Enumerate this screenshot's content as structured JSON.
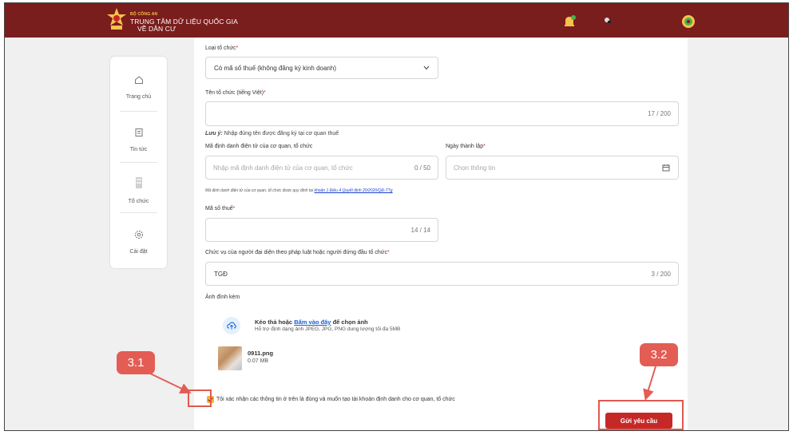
{
  "header": {
    "org_top": "BỘ CÔNG AN",
    "org_line1": "TRUNG TÂM DỮ LIỆU QUỐC GIA",
    "org_line2": "VỀ DÂN CƯ"
  },
  "sidebar": {
    "items": [
      {
        "label": "Trang chủ",
        "icon": "home-icon"
      },
      {
        "label": "Tin tức",
        "icon": "news-icon"
      },
      {
        "label": "Tổ chức",
        "icon": "building-icon"
      },
      {
        "label": "Cài đặt",
        "icon": "gear-icon"
      }
    ]
  },
  "form": {
    "org_type": {
      "label": "Loại tổ chức",
      "required": "*",
      "value": "Có mã số thuế (không đăng ký kinh doanh)"
    },
    "org_name": {
      "label": "Tên tổ chức (tiếng Việt)",
      "required": "*",
      "counter": "17 / 200"
    },
    "note_prefix": "Lưu ý:",
    "note_text": "Nhập đúng tên được đăng ký tại cơ quan thuế",
    "eid": {
      "label": "Mã định danh điện tử của cơ quan, tổ chức",
      "placeholder": "Nhập mã định danh điện tử của cơ quan, tổ chức",
      "counter": "0 / 50"
    },
    "founded": {
      "label": "Ngày thành lập",
      "required": "*",
      "placeholder": "Chọn thông tin"
    },
    "legal_text": "Mã định danh điện tử của cơ quan, tổ chức được quy định tại",
    "legal_link": "khoản 1 Điều 4 Quyết định 20/2020/QĐ-TTg",
    "tax": {
      "label": "Mã số thuế",
      "required": "*",
      "counter": "14 / 14"
    },
    "position": {
      "label": "Chức vụ của người đại diện theo pháp luật hoặc người đứng đầu tổ chức",
      "required": "*",
      "value": "TGĐ",
      "counter": "3 / 200"
    },
    "attachment_label": "Ảnh đính kèm",
    "upload_prefix": "Kéo thả hoặc",
    "upload_link": "Bấm vào đây",
    "upload_suffix": "để chọn ảnh",
    "upload_hint": "Hỗ trợ định dạng ảnh JPEG, JPG, PNG dung lượng tối đa 5MB",
    "file_name": "0911.png",
    "file_size": "0.07 MB",
    "confirm_text": "Tôi xác nhận các thông tin ở trên là đúng và muốn tạo tài khoản định danh cho cơ quan, tổ chức",
    "confirm_checked": true,
    "submit_label": "Gửi yêu cầu"
  },
  "annotations": {
    "callout_checkbox": "3.1",
    "callout_submit": "3.2",
    "accent_color": "#e35d55"
  }
}
